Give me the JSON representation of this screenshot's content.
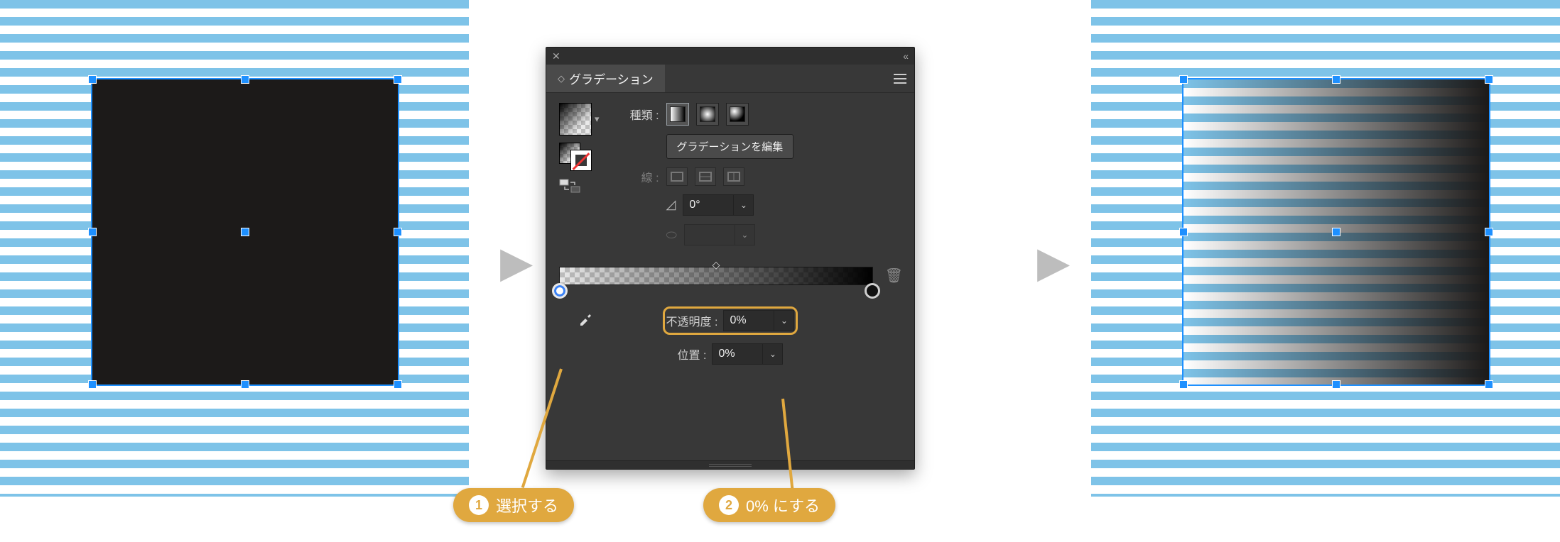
{
  "panel": {
    "title": "グラデーション",
    "type_label": "種類 :",
    "edit_button": "グラデーションを編集",
    "stroke_label": "線 :",
    "angle_value": "0°",
    "opacity_label": "不透明度 :",
    "opacity_value": "0%",
    "location_label": "位置 :",
    "location_value": "0%"
  },
  "callouts": {
    "c1_num": "❶",
    "c1_text": "選択する",
    "c2_num": "❷",
    "c2_text": "0% にする"
  }
}
